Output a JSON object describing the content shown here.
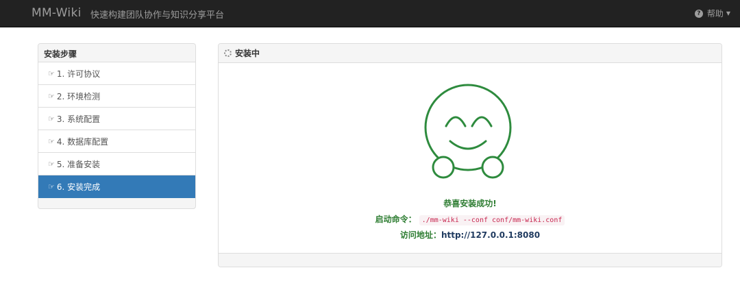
{
  "navbar": {
    "brand": "MM-Wiki",
    "subtitle": "快速构建团队协作与知识分享平台",
    "help_label": "帮助",
    "help_icon": "question-circle-icon",
    "caret_icon": "caret-down-icon"
  },
  "steps": {
    "title": "安装步骤",
    "hand_icon": "hand-right-icon",
    "items": [
      {
        "label": "1. 许可协议"
      },
      {
        "label": "2. 环境检测"
      },
      {
        "label": "3. 系统配置"
      },
      {
        "label": "4. 数据库配置"
      },
      {
        "label": "5. 准备安装"
      },
      {
        "label": "6. 安装完成",
        "active": true
      }
    ]
  },
  "main": {
    "title": "安装中",
    "spinner_icon": "spinner-icon",
    "face_icon": "smiley-face-icon",
    "face_color": "#2e8b3e",
    "success_text": "恭喜安装成功!",
    "start_label": "启动命令：",
    "start_command": "./mm-wiki --conf conf/mm-wiki.conf",
    "access_label": "访问地址：",
    "access_url": "http://127.0.0.1:8080"
  },
  "colors": {
    "navbar_bg": "#222222",
    "active_step_bg": "#337ab7",
    "success_green": "#2e7d32"
  }
}
